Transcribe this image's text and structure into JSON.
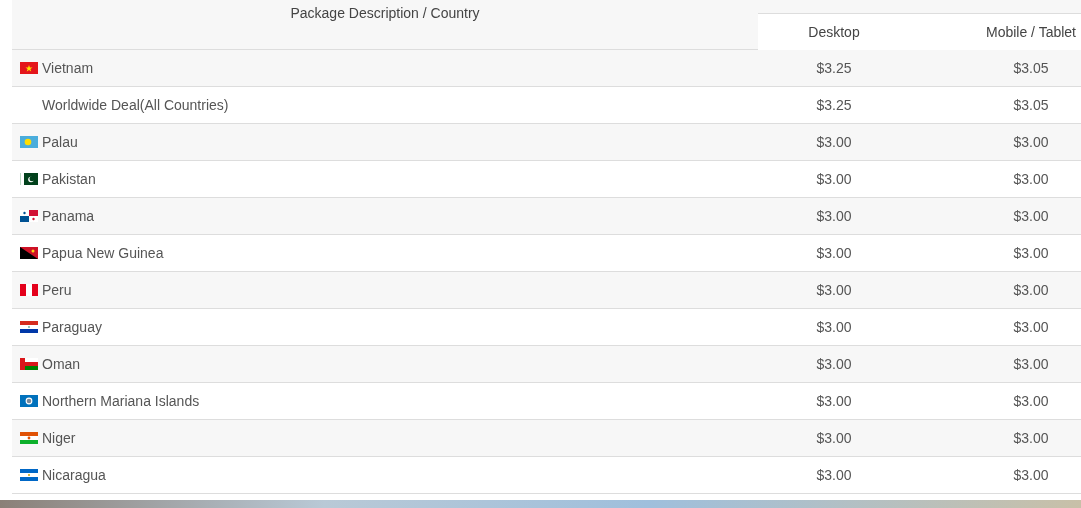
{
  "table": {
    "columns": [
      {
        "label": "Package Description / Country"
      },
      {
        "label": "Desktop"
      },
      {
        "label": "Mobile / Tablet"
      }
    ],
    "rows": [
      {
        "name": "Vietnam",
        "desktop": "$3.25",
        "mobile": "$3.05"
      },
      {
        "name": "Worldwide Deal(All Countries)",
        "desktop": "$3.25",
        "mobile": "$3.05"
      },
      {
        "name": "Palau",
        "desktop": "$3.00",
        "mobile": "$3.00"
      },
      {
        "name": "Pakistan",
        "desktop": "$3.00",
        "mobile": "$3.00"
      },
      {
        "name": "Panama",
        "desktop": "$3.00",
        "mobile": "$3.00"
      },
      {
        "name": "Papua New Guinea",
        "desktop": "$3.00",
        "mobile": "$3.00"
      },
      {
        "name": "Peru",
        "desktop": "$3.00",
        "mobile": "$3.00"
      },
      {
        "name": "Paraguay",
        "desktop": "$3.00",
        "mobile": "$3.00"
      },
      {
        "name": "Oman",
        "desktop": "$3.00",
        "mobile": "$3.00"
      },
      {
        "name": "Northern Mariana Islands",
        "desktop": "$3.00",
        "mobile": "$3.00"
      },
      {
        "name": "Niger",
        "desktop": "$3.00",
        "mobile": "$3.00"
      },
      {
        "name": "Nicaragua",
        "desktop": "$3.00",
        "mobile": "$3.00"
      }
    ]
  }
}
